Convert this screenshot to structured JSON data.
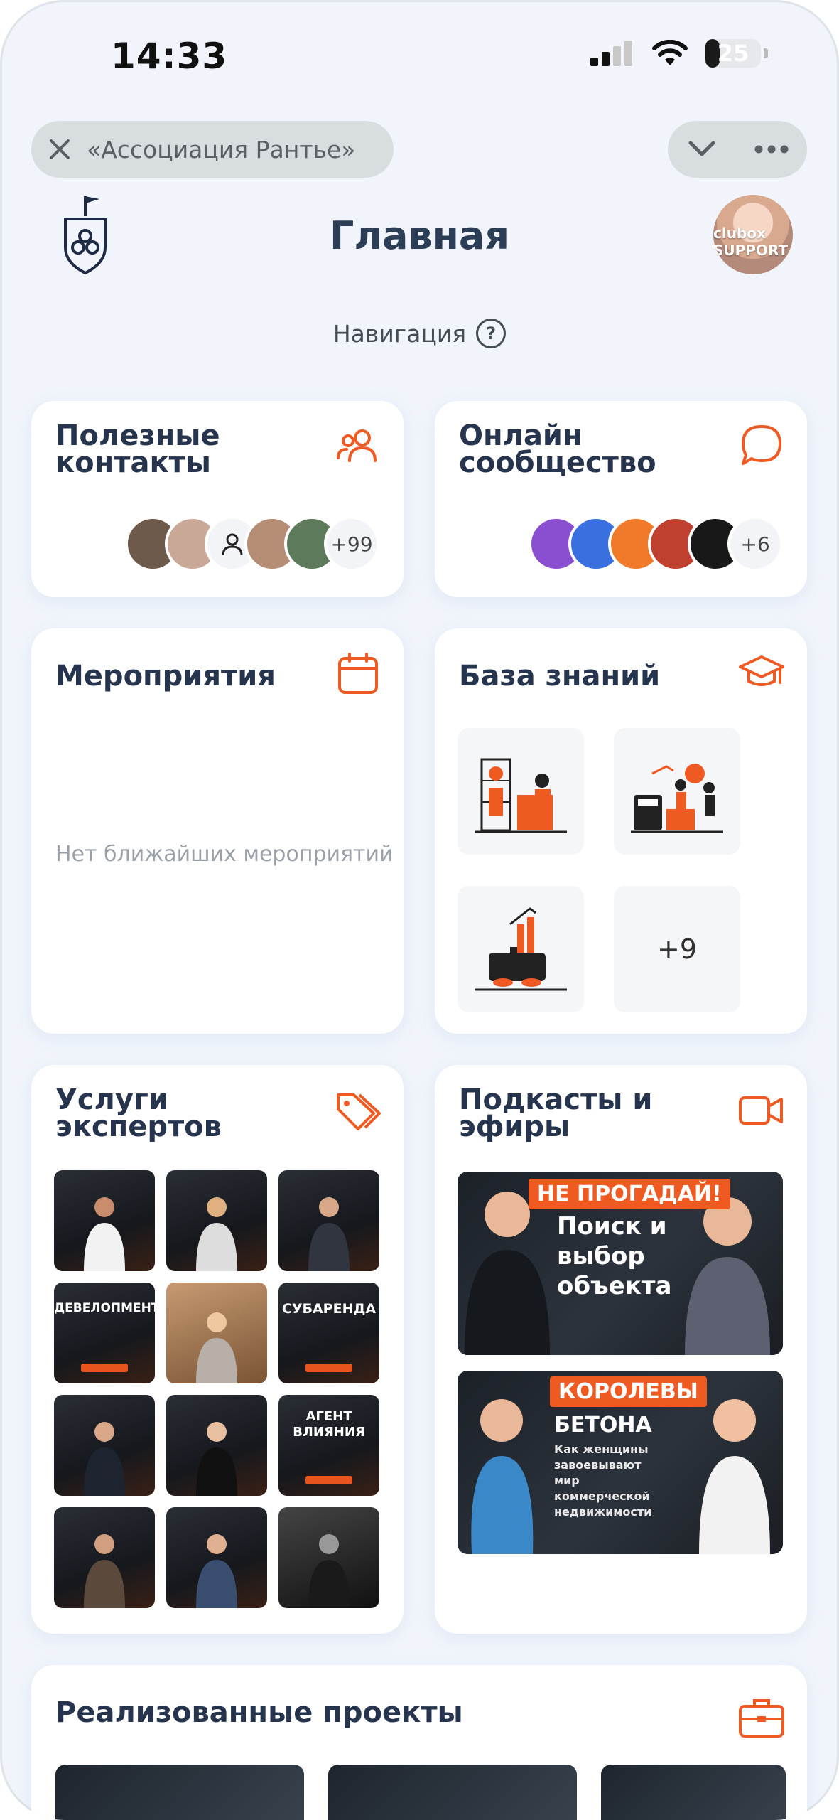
{
  "status_bar": {
    "time": "14:33",
    "battery": "25",
    "battery_level": 0.25
  },
  "top_bar": {
    "title": "«Ассоциация Рантье»"
  },
  "header": {
    "title": "Главная",
    "avatar_text": "clubox SUPPORT"
  },
  "navigation": {
    "label": "Навигация",
    "help": "?"
  },
  "cards": {
    "contacts": {
      "title": "Полезные контакты",
      "more": "+99"
    },
    "community": {
      "title": "Онлайн сообщество",
      "more": "+6"
    },
    "events": {
      "title": "Мероприятия",
      "empty": "Нет ближайших мероприятий"
    },
    "knowledge": {
      "title": "База знаний",
      "more": "+9"
    },
    "experts": {
      "title": "Услуги экспертов",
      "tiles": [
        {
          "text": ""
        },
        {
          "text": ""
        },
        {
          "text": ""
        },
        {
          "text": "ДЕВЕЛОПМЕНТ"
        },
        {
          "text": ""
        },
        {
          "text": "СУБАРЕНДА"
        },
        {
          "text": ""
        },
        {
          "text": ""
        },
        {
          "text": "АГЕНТ ВЛИЯНИЯ"
        },
        {
          "text": ""
        },
        {
          "text": ""
        },
        {
          "text": ""
        }
      ]
    },
    "podcasts": {
      "title": "Подкасты и эфиры",
      "items": [
        {
          "tag": "НЕ ПРОГАДАЙ!",
          "headline": "Поиск и выбор объекта",
          "subtitle": ""
        },
        {
          "tag": "КОРОЛЕВЫ",
          "headline": "БЕТОНА",
          "subtitle": "Как женщины завоевывают мир коммерческой недвижимости"
        }
      ]
    },
    "projects": {
      "title": "Реализованные проекты"
    }
  },
  "colors": {
    "accent": "#ef5a22",
    "text": "#26344d",
    "background": "#f1f5fb"
  }
}
